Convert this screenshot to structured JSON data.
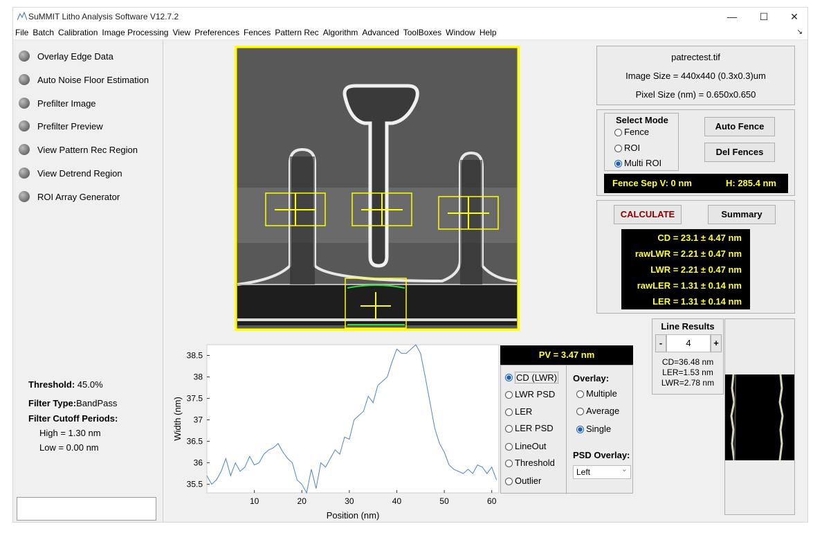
{
  "app": {
    "title": "SuMMIT Litho Analysis Software V12.7.2"
  },
  "window_controls": {
    "minimize": "—",
    "maximize": "☐",
    "close": "✕"
  },
  "menu": [
    "File",
    "Batch",
    "Calibration",
    "Image Processing",
    "View",
    "Preferences",
    "Fences",
    "Pattern Rec",
    "Algorithm",
    "Advanced",
    "ToolBoxes",
    "Window",
    "Help"
  ],
  "left_toggles": [
    {
      "label": "Overlay Edge Data",
      "on": true
    },
    {
      "label": "Auto Noise Floor Estimation",
      "on": false
    },
    {
      "label": "Prefilter Image",
      "on": false
    },
    {
      "label": "Prefilter Preview",
      "on": false
    },
    {
      "label": "View Pattern Rec Region",
      "on": false
    },
    {
      "label": "View Detrend Region",
      "on": false
    },
    {
      "label": "ROI Array Generator",
      "on": false
    }
  ],
  "settings": {
    "threshold_label": "Threshold:",
    "threshold_value": "45.0%",
    "filter_type_label": "Filter Type:",
    "filter_type_value": "BandPass",
    "cutoff_label": "Filter Cutoff Periods:",
    "high": "High =  1.30 nm",
    "low": "Low =  0.00 nm"
  },
  "file_info": {
    "name": "patrectest.tif",
    "image_size": "Image Size = 440x440 (0.3x0.3)um",
    "pixel_size": "Pixel Size (nm) = 0.650x0.650"
  },
  "select_mode": {
    "title": "Select Mode",
    "options": [
      "Fence",
      "ROI",
      "Multi ROI"
    ],
    "selected": 2,
    "auto_fence": "Auto Fence",
    "del_fences": "Del Fences",
    "fence_sep_v": "Fence Sep  V:  0 nm",
    "fence_sep_h": "H:  285.4 nm"
  },
  "calc": {
    "calculate": "CALCULATE",
    "summary": "Summary",
    "results": [
      "CD = 23.1 ± 4.47 nm",
      "rawLWR =  2.21 ± 0.47 nm",
      "LWR =  2.21 ± 0.47 nm",
      "rawLER =  1.31 ± 0.14 nm",
      "LER =  1.31 ± 0.14 nm"
    ]
  },
  "line_results": {
    "title": "Line Results",
    "minus": "-",
    "plus": "+",
    "index": "4",
    "cd": "CD=36.48 nm",
    "ler": "LER=1.53 nm",
    "lwr": "LWR=2.78 nm"
  },
  "plot_options": {
    "pv": "PV =  3.47 nm",
    "modes": [
      "CD (LWR)",
      "LWR PSD",
      "LER",
      "LER PSD",
      "LineOut",
      "Threshold",
      "Outlier"
    ],
    "mode_selected": 0,
    "overlay_title": "Overlay:",
    "overlays": [
      "Multiple",
      "Average",
      "Single"
    ],
    "overlay_selected": 2,
    "psd_title": "PSD Overlay:",
    "psd_value": "Left",
    "psd_chevron": "⌄"
  },
  "colors": {
    "accent": "#1a5fb4",
    "yellow": "#ffff33",
    "highlight_red": "#8b0000",
    "line": "#4a86c8"
  },
  "chart_data": {
    "type": "line",
    "xlabel": "Position (nm)",
    "ylabel": "Width (nm)",
    "xlim": [
      0,
      61.5
    ],
    "ylim": [
      35.3,
      38.75
    ],
    "xticks": [
      10,
      20,
      30,
      40,
      50,
      60
    ],
    "yticks": [
      35.5,
      36,
      36.5,
      37,
      37.5,
      38,
      38.5
    ],
    "series": [
      {
        "x": [
          0,
          1,
          2,
          3,
          4,
          5,
          6,
          7,
          8,
          9,
          10,
          11,
          12,
          13,
          14,
          15,
          16,
          17,
          18,
          19,
          20,
          21,
          22,
          23,
          24,
          25,
          26,
          27,
          28,
          29,
          30,
          31,
          32,
          33,
          34,
          35,
          36,
          37,
          38,
          39,
          40,
          41,
          42,
          43,
          44,
          45,
          46,
          47,
          48,
          49,
          50,
          51,
          52,
          53,
          54,
          55,
          56,
          57,
          58,
          59,
          60,
          61
        ],
        "y": [
          35.7,
          35.5,
          35.6,
          35.8,
          36.1,
          35.7,
          36.0,
          35.8,
          35.9,
          36.15,
          35.95,
          36.0,
          36.2,
          36.3,
          36.35,
          36.45,
          36.25,
          36.1,
          36.0,
          35.6,
          35.5,
          35.25,
          35.85,
          35.4,
          36.0,
          35.9,
          36.1,
          36.3,
          36.2,
          36.6,
          36.55,
          37.0,
          37.1,
          37.2,
          37.55,
          37.4,
          37.8,
          37.9,
          38.0,
          38.35,
          38.65,
          38.55,
          38.55,
          38.65,
          38.75,
          38.55,
          38.0,
          37.4,
          36.8,
          36.45,
          36.25,
          35.95,
          35.85,
          35.8,
          35.75,
          35.85,
          35.75,
          35.95,
          35.9,
          35.75,
          35.9,
          35.6
        ]
      }
    ]
  }
}
